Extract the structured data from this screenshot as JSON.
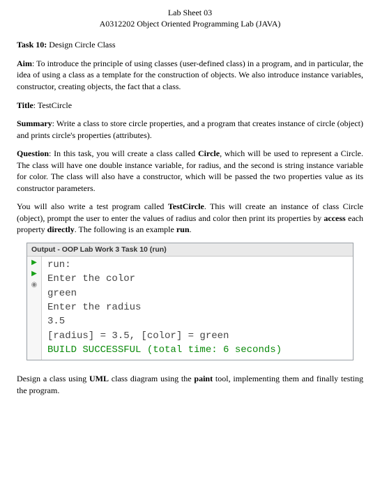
{
  "header": {
    "line1": "Lab Sheet 03",
    "line2": "A0312202 Object Oriented Programming Lab (JAVA)"
  },
  "task": {
    "label": "Task 10:",
    "title": "Design Circle Class"
  },
  "aim": {
    "label": "Aim",
    "text": ": To introduce the principle of using classes (user-defined class) in a program, and in particular, the idea of using a class as a template for the construction of objects. We also introduce instance variables, constructor, creating objects, the fact that a class."
  },
  "titleSec": {
    "label": "Title",
    "text": ": TestCircle"
  },
  "summary": {
    "label": "Summary",
    "text": ": Write a class to store circle properties, and a program that creates instance of circle (object) and prints circle's properties (attributes)."
  },
  "question": {
    "label": "Question",
    "pre": ": In this task, you will create a class called ",
    "classname": "Circle",
    "post": ", which will be used to represent a Circle. The class will have one double instance variable, for radius, and the second is string instance variable for color. The class will also have a constructor, which will be passed the two properties value as its constructor parameters."
  },
  "para2": {
    "pre": "You will also write a test program called ",
    "testname": "TestCircle",
    "mid": ". This will create an instance of class Circle (object), prompt the user to enter the values of radius and color then print its properties by ",
    "access": "access",
    "mid2": " each property ",
    "directly": "directly",
    "post": ". The following is an example ",
    "run": "run",
    "end": "."
  },
  "output": {
    "title": "Output - OOP Lab Work 3 Task 10 (run)",
    "lines": {
      "l0": "run:",
      "l1": "Enter the color",
      "l2": "green",
      "l3": "Enter the radius",
      "l4": "3.5",
      "l5": "[radius] = 3.5, [color] = green",
      "l6": "BUILD SUCCESSFUL (total time: 6 seconds)"
    }
  },
  "footer": {
    "pre": "Design a class using ",
    "uml": "UML",
    "mid": " class diagram using the ",
    "paint": "paint",
    "post": " tool, implementing them and finally testing the program."
  }
}
